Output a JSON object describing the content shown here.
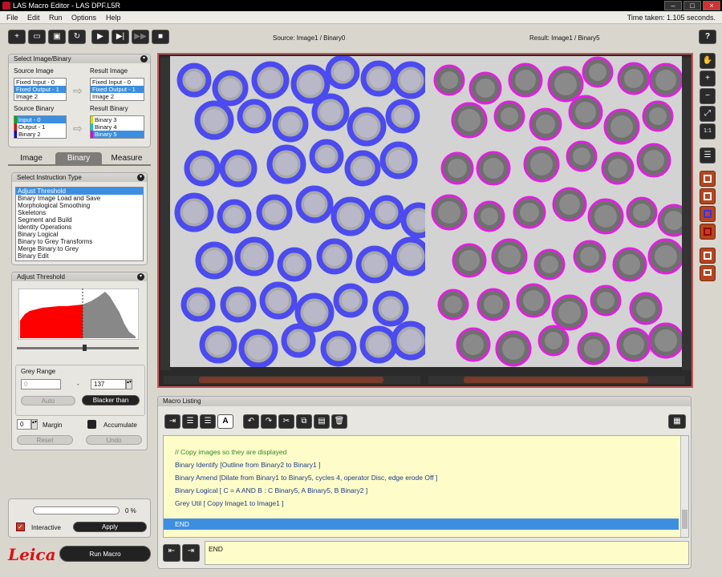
{
  "window": {
    "title": "LAS Macro Editor - LAS DPF.L5R"
  },
  "menu": {
    "file": "File",
    "edit": "Edit",
    "run": "Run",
    "options": "Options",
    "help": "Help"
  },
  "status": {
    "time_taken": "Time taken: 1.105 seconds."
  },
  "viewer": {
    "source_label": "Source: Image1 / Binary0",
    "result_label": "Result: Image1 / Binary5",
    "help": "?"
  },
  "select_panel": {
    "title": "Select Image/Binary",
    "source_image_label": "Source Image",
    "result_image_label": "Result Image",
    "source_binary_label": "Source Binary",
    "result_binary_label": "Result Binary",
    "source_images": [
      "Fixed Input - 0",
      "Fixed Output - 1",
      "Image 2"
    ],
    "result_images": [
      "Fixed Input - 0",
      "Fixed Output - 1",
      "Image 2"
    ],
    "source_binaries": [
      "Input - 0",
      "Output - 1",
      "Binary 2"
    ],
    "result_binaries": [
      "Binary 3",
      "Binary 4",
      "Binary 5"
    ]
  },
  "tabs": {
    "image": "Image",
    "binary": "Binary",
    "measure": "Measure"
  },
  "instruction_panel": {
    "title": "Select Instruction Type",
    "items": [
      "Adjust Threshold",
      "Binary Image Load and Save",
      "Morphological Smoothing",
      "Skeletons",
      "Segment and Build",
      "Identity Operations",
      "Binary Logical",
      "Binary to Grey Transforms",
      "Merge Binary to Grey",
      "Binary Edit"
    ]
  },
  "threshold_panel": {
    "title": "Adjust Threshold",
    "grey_range_label": "Grey Range",
    "low_value": "0",
    "dash": "-",
    "high_value": "137",
    "auto": "Auto",
    "mode": "Blacker than",
    "margin_value": "0",
    "margin_label": "Margin",
    "accumulate_label": "Accumulate",
    "reset": "Reset",
    "undo": "Undo"
  },
  "bottom_left": {
    "progress_text": "0 %",
    "interactive_label": "Interactive",
    "apply": "Apply",
    "run_macro": "Run Macro",
    "logo": "Leica"
  },
  "macro": {
    "title": "Macro Listing",
    "lines": [
      "// Copy images so they are displayed",
      "Binary Identify [Outline from Binary2 to Binary1 ]",
      "Binary Amend [Dilate from Binary1 to Binary5, cycles 4, operator Disc, edge erode Off ]",
      "Binary Logical [ C = A AND B : C Binary5, A Binary5, B Binary2 ]",
      "Grey Util [ Copy Image1 to Image1 ]"
    ],
    "end": "END",
    "edit_line": "END"
  },
  "colors": {
    "source_overlay": "#4b4bf0",
    "result_overlay": "#e020e0",
    "selection": "#3c8fe0",
    "editor_bg": "#fefcc8",
    "accent_red": "#b4461f"
  }
}
